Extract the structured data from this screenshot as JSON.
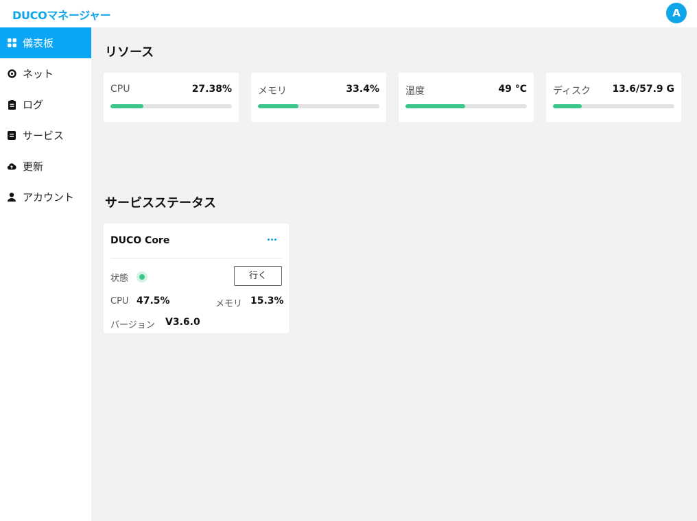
{
  "app": {
    "title": "DUCOマネージャー",
    "avatar_letter": "A"
  },
  "sidebar": {
    "items": [
      {
        "label": "儀表板",
        "icon": "grid-icon",
        "active": true
      },
      {
        "label": "ネット",
        "icon": "circle-icon",
        "active": false
      },
      {
        "label": "ログ",
        "icon": "clipboard-icon",
        "active": false
      },
      {
        "label": "サービス",
        "icon": "service-icon",
        "active": false
      },
      {
        "label": "更新",
        "icon": "cloud-icon",
        "active": false
      },
      {
        "label": "アカウント",
        "icon": "user-icon",
        "active": false
      }
    ]
  },
  "resources": {
    "title": "リソース",
    "cards": [
      {
        "label": "CPU",
        "value": "27.38%",
        "fill": 0.27
      },
      {
        "label": "メモリ",
        "value": "33.4%",
        "fill": 0.334
      },
      {
        "label": "温度",
        "value": "49 °C",
        "fill": 0.49
      },
      {
        "label": "ディスク",
        "value": "13.6/57.9 G",
        "fill": 0.235
      }
    ]
  },
  "services": {
    "title": "サービスステータス",
    "card": {
      "name": "DUCO Core",
      "status_label": "状態",
      "go_label": "行く",
      "cpu_label": "CPU",
      "cpu_value": "47.5%",
      "mem_label": "メモリ",
      "mem_value": "15.3%",
      "version_label": "バージョン",
      "version_value": "V3.6.0"
    }
  },
  "colors": {
    "accent": "#0ea5e9",
    "progress": "#3cc68a"
  }
}
